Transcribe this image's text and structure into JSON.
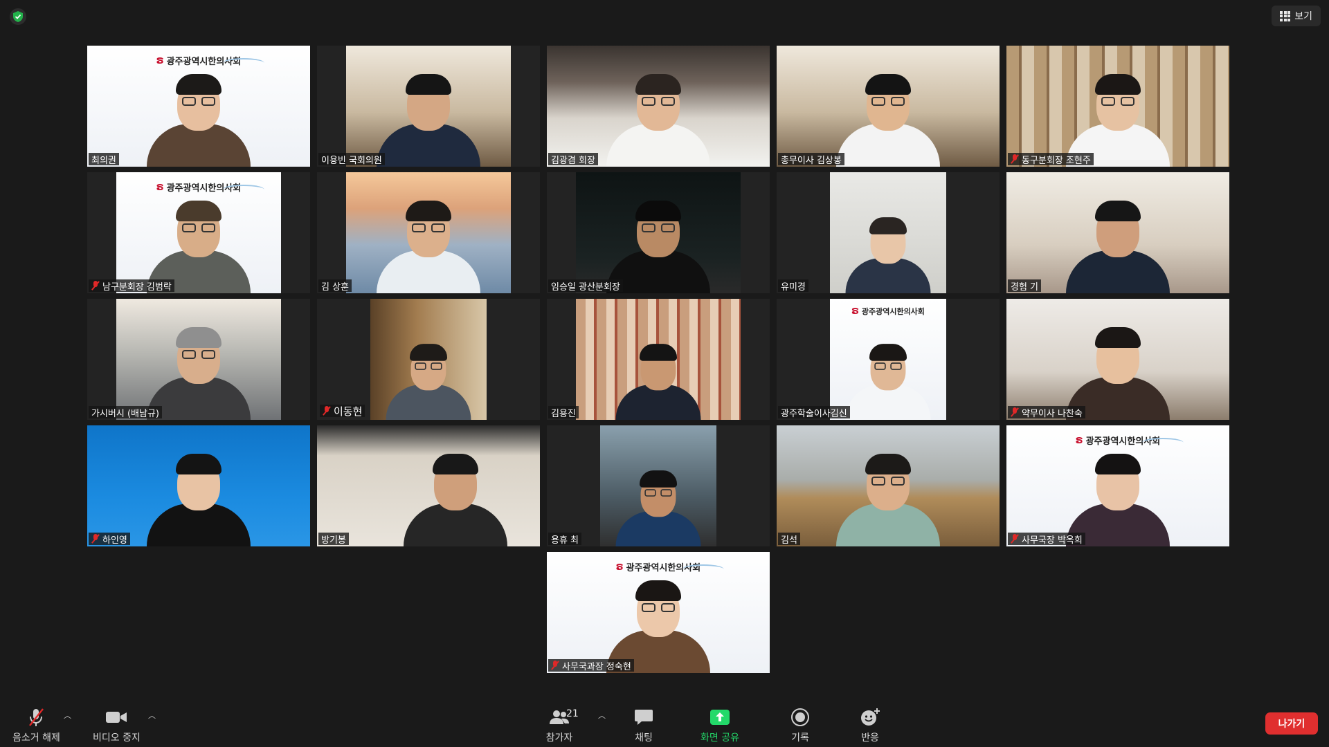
{
  "top": {
    "view_label": "보기",
    "security_icon": "shield-check-icon"
  },
  "colors": {
    "active_speaker": "#e3f05a",
    "muted": "#e02828",
    "leave": "#e02f2f",
    "share": "#23d96a"
  },
  "logo_text": "광주광역시한의사회",
  "participants": [
    {
      "name": "최의권",
      "muted": false,
      "active": false
    },
    {
      "name": "이용빈 국회의원",
      "muted": false,
      "active": false
    },
    {
      "name": "김광겸 회장",
      "muted": false,
      "active": true
    },
    {
      "name": "총무이사 김상봉",
      "muted": false,
      "active": false
    },
    {
      "name": "동구분회장 조현주",
      "muted": true,
      "active": false
    },
    {
      "name": "남구분회장 김범락",
      "muted": true,
      "active": false
    },
    {
      "name": "김 상훈",
      "muted": false,
      "active": false
    },
    {
      "name": "임승일 광산분회장",
      "muted": false,
      "active": false
    },
    {
      "name": "유미경",
      "muted": false,
      "active": false
    },
    {
      "name": "경험 기",
      "muted": false,
      "active": false
    },
    {
      "name": "가시버시 (배남규)",
      "muted": false,
      "active": false
    },
    {
      "name": "이동현",
      "muted": true,
      "active": false
    },
    {
      "name": "김용진",
      "muted": false,
      "active": false
    },
    {
      "name": "광주학술이사김신",
      "muted": false,
      "active": false
    },
    {
      "name": "약무이사 나찬숙",
      "muted": true,
      "active": false
    },
    {
      "name": "하인영",
      "muted": true,
      "active": false
    },
    {
      "name": "방기봉",
      "muted": false,
      "active": false
    },
    {
      "name": "용휴 최",
      "muted": false,
      "active": false
    },
    {
      "name": "김석",
      "muted": false,
      "active": false
    },
    {
      "name": "사무국장 박옥희",
      "muted": true,
      "active": false
    },
    {
      "name": "사무국과장 정숙현",
      "muted": true,
      "active": false
    }
  ],
  "toolbar": {
    "unmute_label": "음소거 해제",
    "video_label": "비디오 중지",
    "participants_label": "참가자",
    "participants_count": "21",
    "chat_label": "채팅",
    "share_label": "화면 공유",
    "record_label": "기록",
    "reactions_label": "반응",
    "leave_label": "나가기"
  }
}
